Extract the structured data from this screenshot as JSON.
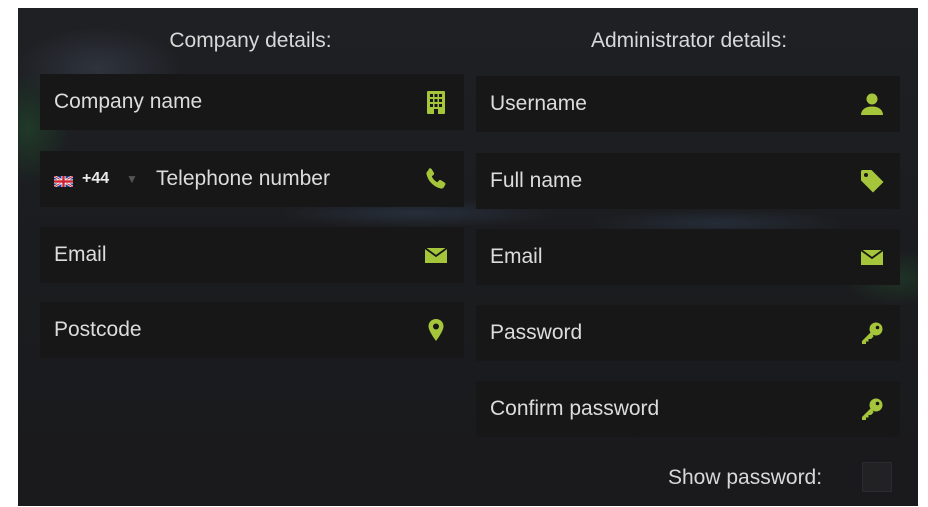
{
  "company": {
    "heading": "Company details:",
    "name_placeholder": "Company name",
    "phone": {
      "flag": "uk-flag-icon",
      "prefix": "+44",
      "placeholder": "Telephone number"
    },
    "email_placeholder": "Email",
    "postcode_placeholder": "Postcode"
  },
  "administrator": {
    "heading": "Administrator details:",
    "username_placeholder": "Username",
    "fullname_placeholder": "Full name",
    "email_placeholder": "Email",
    "password_placeholder": "Password",
    "confirm_password_placeholder": "Confirm password",
    "show_password_label": "Show password:"
  },
  "icons": {
    "company_name": "building-icon",
    "telephone": "phone-icon",
    "email": "envelope-icon",
    "postcode": "map-marker-icon",
    "username": "user-icon",
    "fullname": "tag-icon",
    "password": "key-icon"
  },
  "colors": {
    "accent": "#a5c63b",
    "field_bg": "#171717",
    "text": "#dcdcdc"
  }
}
